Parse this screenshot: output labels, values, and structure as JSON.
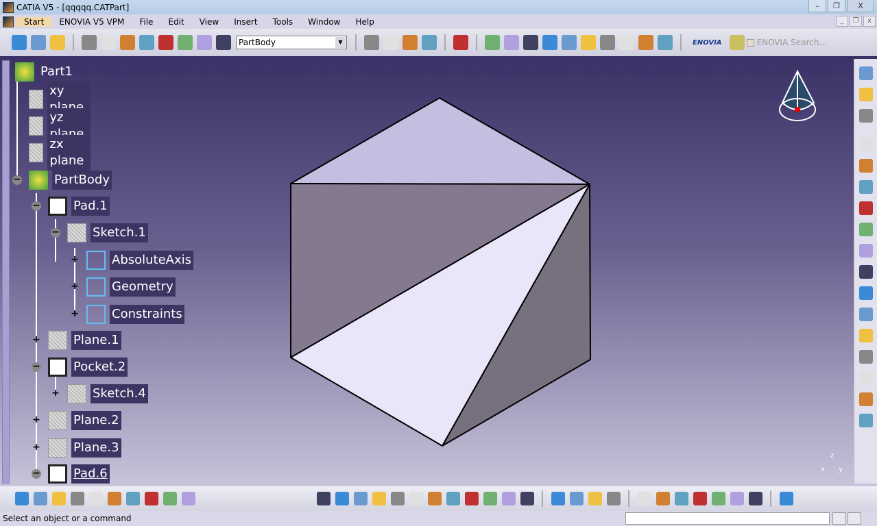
{
  "window": {
    "title": "CATIA V5 - [qqqqq.CATPart]",
    "minimize": "–",
    "restore": "❐",
    "close": "X"
  },
  "menu": [
    "Start",
    "ENOVIA V5 VPM",
    "File",
    "Edit",
    "View",
    "Insert",
    "Tools",
    "Window",
    "Help"
  ],
  "toolbar": {
    "current_body": "PartBody",
    "enovia_logo": "ENOVIA",
    "enovia_search_placeholder": "ENOVIA Search...",
    "icons_left": [
      "product-icon",
      "select-icon",
      "whats-this-icon",
      "update-icon",
      "hand-icon",
      "axis-icon",
      "measure-icon",
      "layers-icon",
      "analysis-icon",
      "list-icon",
      "plane-icon"
    ],
    "icons_right": [
      "scene-icon",
      "assembly-icon",
      "copy-icon",
      "link-icon",
      "sketcher-icon",
      "pad-icon",
      "pocket-icon",
      "shaft-icon",
      "groove-icon",
      "hole-icon",
      "rib-icon",
      "slot-icon",
      "solid-combine-icon",
      "stiffener-icon",
      "multi-section-icon"
    ]
  },
  "tree": [
    {
      "label": "Part1",
      "level": 0,
      "toggle": "",
      "icon": "part-icon"
    },
    {
      "label": "xy plane",
      "level": 1,
      "toggle": "",
      "icon": "plane-icon"
    },
    {
      "label": "yz plane",
      "level": 1,
      "toggle": "",
      "icon": "plane-icon"
    },
    {
      "label": "zx plane",
      "level": 1,
      "toggle": "",
      "icon": "plane-icon"
    },
    {
      "label": "PartBody",
      "level": 1,
      "toggle": "−",
      "icon": "body-icon"
    },
    {
      "label": "Pad.1",
      "level": 2,
      "toggle": "−",
      "icon": "pad-icon"
    },
    {
      "label": "Sketch.1",
      "level": 3,
      "toggle": "−",
      "icon": "sketch-icon"
    },
    {
      "label": "AbsoluteAxis",
      "level": 4,
      "toggle": "+",
      "icon": "axis-icon"
    },
    {
      "label": "Geometry",
      "level": 4,
      "toggle": "+",
      "icon": "geometry-icon"
    },
    {
      "label": "Constraints",
      "level": 4,
      "toggle": "+",
      "icon": "constraints-icon"
    },
    {
      "label": "Plane.1",
      "level": 2,
      "toggle": "+",
      "icon": "plane-icon"
    },
    {
      "label": "Pocket.2",
      "level": 2,
      "toggle": "−",
      "icon": "pocket-icon"
    },
    {
      "label": "Sketch.4",
      "level": 3,
      "toggle": "+",
      "icon": "sketch-icon"
    },
    {
      "label": "Plane.2",
      "level": 2,
      "toggle": "+",
      "icon": "plane-icon"
    },
    {
      "label": "Plane.3",
      "level": 2,
      "toggle": "+",
      "icon": "plane-icon"
    },
    {
      "label": "Pad.6",
      "level": 2,
      "toggle": "−",
      "icon": "pad-icon"
    }
  ],
  "axes": {
    "x": "x",
    "y": "y",
    "z": "z"
  },
  "right_toolbar": [
    "apply-material-icon",
    "catalog-icon",
    "formula-icon",
    "surface-icon",
    "draft-icon",
    "shell-icon",
    "thickness-icon",
    "thread-icon",
    "remove-face-icon",
    "replace-face-icon",
    "pattern-icon",
    "point-icon",
    "line-icon",
    "plane-tool-icon",
    "boolean-icon",
    "constraint-icon",
    "knowledge-icon"
  ],
  "bottom_toolbar": [
    "new-icon",
    "open-icon",
    "save-icon",
    "print-icon",
    "cut-icon",
    "copy-icon",
    "paste-icon",
    "undo-icon",
    "redo-icon",
    "whats-this-icon",
    "fly-icon",
    "fit-all-icon",
    "pan-icon",
    "rotate-icon",
    "zoom-in-icon",
    "zoom-out-icon",
    "normal-view-icon",
    "multi-view-icon",
    "iso-view-icon",
    "render-style-icon",
    "hide-show-icon",
    "swap-icon",
    "capture-icon",
    "measure-between-icon",
    "measure-item-icon",
    "inertia-icon",
    "formula-fx-icon",
    "comment-icon",
    "law-icon",
    "table-icon",
    "tree-icon",
    "lock-icon",
    "parameters-icon",
    "catia-logo-icon"
  ],
  "status": {
    "message": "Select an object or a command"
  },
  "colors": {
    "tree_label_bg": "#3c3462",
    "viewport_top": "#3a3266",
    "viewport_bottom": "#c8c4da"
  }
}
